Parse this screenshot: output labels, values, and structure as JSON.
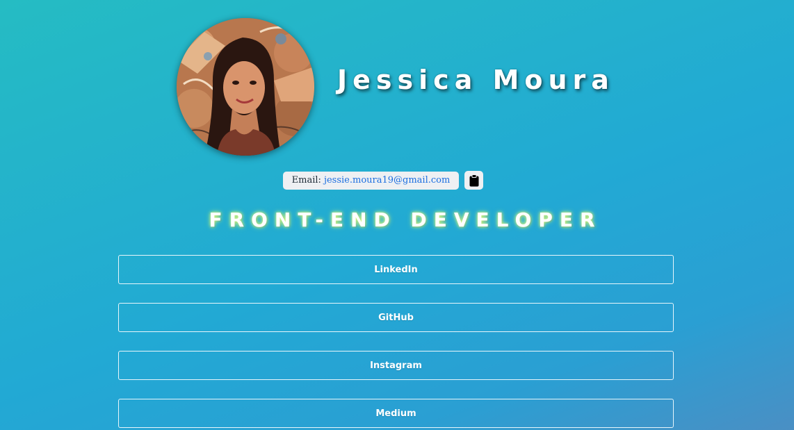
{
  "profile": {
    "name": "Jessica Moura",
    "avatar_alt": "profile photo"
  },
  "contact": {
    "email_label": "Email:",
    "email_value": "jessie.moura19@gmail.com",
    "copy_icon": "clipboard-icon"
  },
  "headline": "FRONT-END DEVELOPER",
  "links": [
    {
      "label": "LinkedIn"
    },
    {
      "label": "GitHub"
    },
    {
      "label": "Instagram"
    },
    {
      "label": "Medium"
    }
  ],
  "colors": {
    "background_start": "#25bcc3",
    "background_end": "#4a8fc4",
    "text": "#ffffff",
    "link_email": "#1d6fe0",
    "headline_glow": "#e6ff7a"
  }
}
